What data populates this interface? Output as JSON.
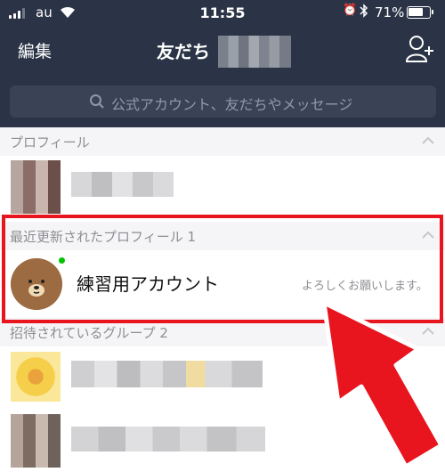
{
  "status_bar": {
    "carrier": "au",
    "time": "11:55",
    "battery_percent": "71%",
    "battery_level": 0.71
  },
  "nav": {
    "edit_label": "編集",
    "title": "友だち"
  },
  "search": {
    "placeholder": "公式アカウント、友だちやメッセージ"
  },
  "sections": {
    "profile": "プロフィール",
    "recent": "最近更新されたプロフィール 1",
    "invited": "招待されているグループ 2"
  },
  "friend": {
    "name": "練習用アカウント",
    "status_message": "よろしくお願いします。"
  },
  "colors": {
    "header_bg": "#2b3446",
    "highlight": "#e8141e",
    "online": "#00c300"
  },
  "icons": [
    "wifi-icon",
    "alarm-icon",
    "bluetooth-icon",
    "battery-icon",
    "add-friend-icon",
    "search-icon",
    "chevron-up-icon",
    "red-arrow-icon"
  ]
}
